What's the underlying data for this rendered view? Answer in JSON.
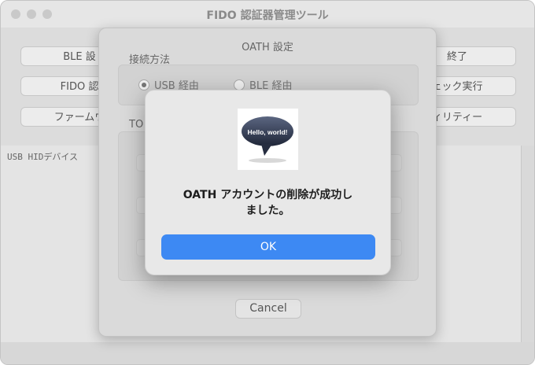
{
  "window": {
    "title": "FIDO 認証器管理ツール"
  },
  "main": {
    "buttons_left": [
      "BLE 設",
      "FIDO 認",
      "ファームウ"
    ],
    "buttons_right": [
      "終了",
      "ェック実行",
      "ィリティー"
    ],
    "log_text": "USB HIDデバイス"
  },
  "oath_sheet": {
    "title": "OATH 設定",
    "connection_label": "接続方法",
    "radio_usb": "USB 経由",
    "radio_ble": "BLE 経由",
    "selected": "USB 経由",
    "section2_label": "TO",
    "cancel_label": "Cancel"
  },
  "alert": {
    "icon_text": "Hello, world!",
    "message_line1": "OATH アカウントの削除が成功し",
    "message_line2": "ました。",
    "ok_label": "OK"
  },
  "colors": {
    "accent": "#3d89f3",
    "alert_bg": "#e8e8e8"
  }
}
